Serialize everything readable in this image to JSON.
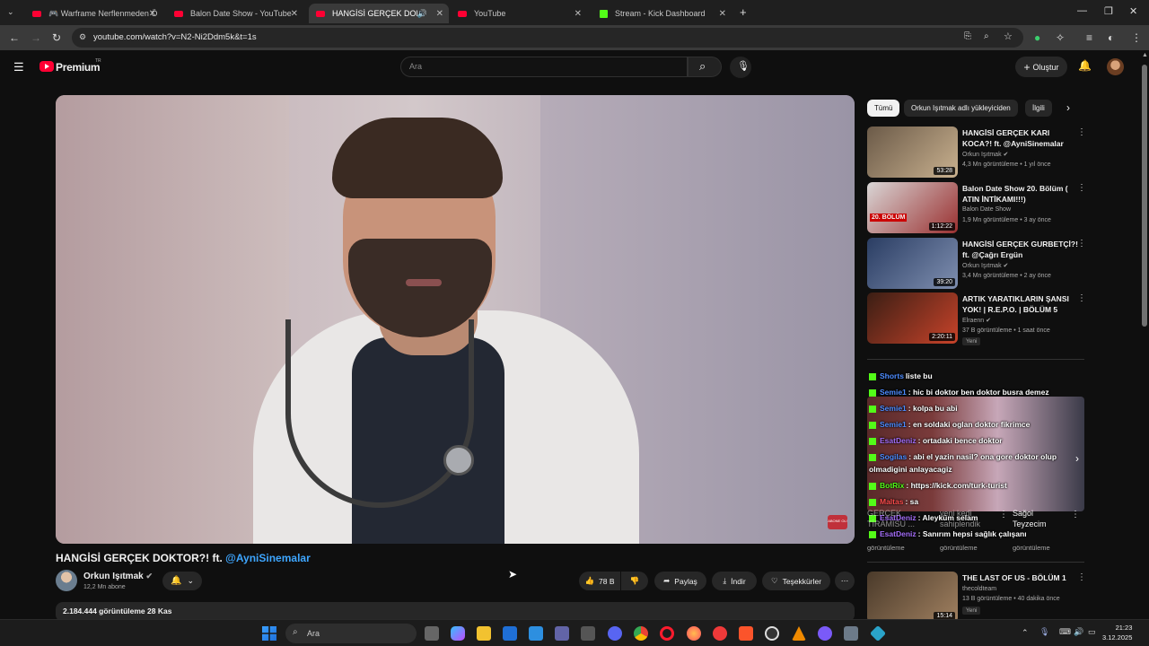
{
  "browser": {
    "tabs": [
      {
        "label": "🎮 Warframe Nerflenmeden Ö",
        "icon": "youtube-icon",
        "active": false
      },
      {
        "label": "Balon Date Show - YouTube",
        "icon": "youtube-icon",
        "active": false
      },
      {
        "label": "HANGİSİ GERÇEK DOKTOR",
        "icon": "youtube-icon",
        "active": true
      },
      {
        "label": "YouTube",
        "icon": "youtube-icon",
        "active": false
      },
      {
        "label": "Stream - Kick Dashboard",
        "icon": "kick-icon",
        "active": false
      }
    ],
    "url": "youtube.com/watch?v=N2-Ni2Ddm5k&t=1s"
  },
  "header": {
    "logo_text": "Premium",
    "logo_sup": "TR",
    "search_placeholder": "Ara",
    "create_label": "Oluştur"
  },
  "video": {
    "title_main": "HANGİSİ GERÇEK DOKTOR?! ft. ",
    "title_mention": "@AyniSinemalar",
    "channel": "Orkun Işıtmak",
    "subscribers": "12,2 Mn abone",
    "likes": "78 B",
    "share_label": "Paylaş",
    "download_label": "İndir",
    "thanks_label": "Teşekkürler",
    "views_date": "2.184.444 görüntüleme  28 Kas",
    "subscribe_watermark": "ABONE OL!"
  },
  "chips": [
    "Tümü",
    "Orkun Işıtmak adlı yükleyiciden",
    "İlgili"
  ],
  "recommendations": [
    {
      "title": "HANGİSİ GERÇEK KARI KOCA?! ft. @AyniSinemalar",
      "channel": "Orkun Işıtmak",
      "verified": true,
      "meta": "4,3 Mn görüntüleme • 1 yıl önce",
      "duration": "53:28",
      "colors": [
        "#6b5a48",
        "#c9b18f"
      ]
    },
    {
      "title": "Balon Date Show 20. Bölüm ( ATIN İNTİKAMI!!!)",
      "channel": "Balon Date Show",
      "verified": false,
      "meta": "1,9 Mn görüntüleme • 3 ay önce",
      "duration": "1:12:22",
      "colors": [
        "#d9d6d6",
        "#9a3030"
      ]
    },
    {
      "title": "HANGİSİ GERÇEK GURBETÇİ?! ft. @Çağrı Ergün",
      "channel": "Orkun Işıtmak",
      "verified": true,
      "meta": "3,4 Mn görüntüleme • 2 ay önce",
      "duration": "39:20",
      "colors": [
        "#2a3d63",
        "#7f8fb0"
      ]
    },
    {
      "title": "ARTIK YARATIKLARIN ŞANSI YOK! | R.E.P.O. | BÖLÜM 5",
      "channel": "Elraenn",
      "verified": true,
      "meta": "37 B görüntüleme • 1 saat önce",
      "duration": "2:20:11",
      "badge": "Yeni",
      "colors": [
        "#3a1e14",
        "#c8432a"
      ]
    },
    {
      "title": "THE LAST OF US - BÖLÜM 1",
      "channel": "thecoldteam",
      "verified": false,
      "meta": "13 B görüntüleme • 40 dakika önce",
      "duration": "15:14",
      "badge": "Yeni",
      "colors": [
        "#4a3a2a",
        "#a08060"
      ]
    }
  ],
  "chat": [
    {
      "user": "Shorts",
      "text": "liste bu",
      "color": "blue"
    },
    {
      "user": "Semie1",
      "text": ": hic bi doktor ben doktor busra demez",
      "color": "blue"
    },
    {
      "user": "Semie1",
      "text": ": kolpa bu abi",
      "color": "blue"
    },
    {
      "user": "Semie1",
      "text": ": en soldaki oglan doktor fikrimce",
      "color": "blue"
    },
    {
      "user": "EsatDeniz",
      "text": ": ortadaki bence doktor",
      "color": "purple"
    },
    {
      "user": "Sogilas",
      "text": ": abi el yazin nasil? ona gore doktor olup",
      "color": "blue"
    },
    {
      "user": "",
      "text": "olmadigini anlayacagiz",
      "color": "blue"
    },
    {
      "user": "BotRix",
      "text": ": https://kick.com/turk-turist",
      "color": "green"
    },
    {
      "user": "Maltas",
      "text": ": sa",
      "color": "red"
    },
    {
      "user": "EsatDeniz",
      "text": ": Aleyküm selam",
      "color": "purple"
    },
    {
      "user": "EsatDeniz",
      "text": ": Sanırım hepsi sağlık çalışanı",
      "color": "purple"
    }
  ],
  "shorts": [
    {
      "title": "GERÇEK TİRAMİSU ...",
      "meta": "görüntüleme"
    },
    {
      "title": "yeni kedi sahiplendik",
      "meta": "görüntüleme"
    },
    {
      "title": "Sağol Teyzecim",
      "meta": "görüntüleme"
    }
  ],
  "taskbar": {
    "search_label": "Ara",
    "time": "21:23",
    "date": "3.12.2025"
  }
}
